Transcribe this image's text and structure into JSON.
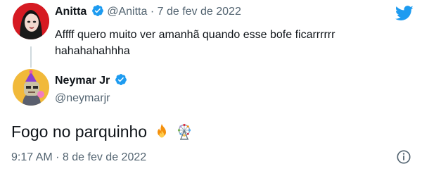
{
  "reply": {
    "author_name": "Anitta",
    "handle": "@Anitta",
    "separator": "·",
    "date": "7 de fev de 2022",
    "text": "Affff quero muito ver amanhã quando esse bofe ficarrrrrr hahahahahhha"
  },
  "main_tweet": {
    "author_name": "Neymar Jr",
    "handle": "@neymarjr",
    "text": "Fogo no parquinho",
    "timestamp": "9:17 AM · 8 de fev de 2022"
  },
  "colors": {
    "verified_blue": "#1d9bf0",
    "twitter_blue": "#1d9bf0",
    "text_primary": "#0f1419",
    "text_secondary": "#536471"
  },
  "icons": {
    "brand": "twitter-bird-icon",
    "verified": "verified-badge-icon",
    "emoji_1": "fire-emoji-icon",
    "emoji_2": "ferris-wheel-emoji-icon",
    "info": "info-icon"
  }
}
